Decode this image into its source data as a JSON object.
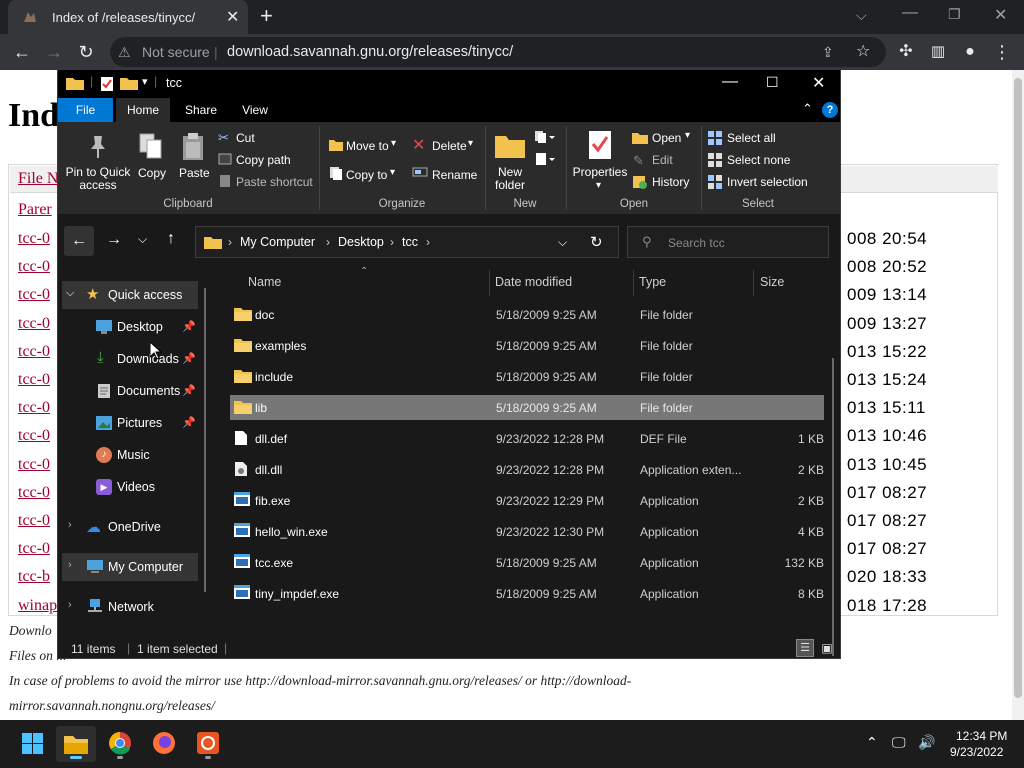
{
  "browser": {
    "tab_title": "Index of /releases/tinycc/",
    "new_tab": "+",
    "security_label": "Not secure",
    "url": "download.savannah.gnu.org/releases/tinycc/"
  },
  "webpage": {
    "title_partial": "Ind",
    "header_partial": "File N",
    "parent_link": "Parer",
    "links": [
      "tcc-0",
      "tcc-0",
      "tcc-0",
      "tcc-0",
      "tcc-0",
      "tcc-0",
      "tcc-0",
      "tcc-0",
      "tcc-0",
      "tcc-0",
      "tcc-0",
      "tcc-0",
      "tcc-b",
      "winap"
    ],
    "dates": [
      "008 20:54",
      "008 20:52",
      "009 13:14",
      "009 13:27",
      "013 15:22",
      "013 15:24",
      "013 15:11",
      "013 10:46",
      "013 10:45",
      "017 08:27",
      "017 08:27",
      "017 08:27",
      "020 18:33",
      "018 17:28"
    ],
    "note1": "Downlo",
    "note2": "Files on ...",
    "note3": "In case of problems to avoid the mirror use http://download-mirror.savannah.gnu.org/releases/ or http://download-",
    "note4": "mirror.savannah.nongnu.org/releases/"
  },
  "explorer": {
    "title": "tcc",
    "ribbon_tabs": [
      "File",
      "Home",
      "Share",
      "View"
    ],
    "clipboard": {
      "pin": "Pin to Quick access",
      "copy": "Copy",
      "paste": "Paste",
      "cut": "Cut",
      "copy_path": "Copy path",
      "paste_shortcut": "Paste shortcut",
      "label": "Clipboard"
    },
    "organize": {
      "move_to": "Move to",
      "copy_to": "Copy to",
      "delete": "Delete",
      "rename": "Rename",
      "label": "Organize"
    },
    "new_group": {
      "new_folder": "New folder",
      "label": "New"
    },
    "open_group": {
      "properties": "Properties",
      "open": "Open",
      "edit": "Edit",
      "history": "History",
      "label": "Open"
    },
    "select_group": {
      "select_all": "Select all",
      "select_none": "Select none",
      "invert": "Invert selection",
      "label": "Select"
    },
    "breadcrumb": [
      "My Computer",
      "Desktop",
      "tcc"
    ],
    "search_placeholder": "Search tcc",
    "nav": {
      "quick_access": "Quick access",
      "desktop": "Desktop",
      "downloads": "Downloads",
      "documents": "Documents",
      "pictures": "Pictures",
      "music": "Music",
      "videos": "Videos",
      "onedrive": "OneDrive",
      "my_computer": "My Computer",
      "network": "Network"
    },
    "columns": {
      "name": "Name",
      "date": "Date modified",
      "type": "Type",
      "size": "Size"
    },
    "files": [
      {
        "name": "doc",
        "date": "5/18/2009 9:25 AM",
        "type": "File folder",
        "size": "",
        "icon": "folder"
      },
      {
        "name": "examples",
        "date": "5/18/2009 9:25 AM",
        "type": "File folder",
        "size": "",
        "icon": "folder"
      },
      {
        "name": "include",
        "date": "5/18/2009 9:25 AM",
        "type": "File folder",
        "size": "",
        "icon": "folder"
      },
      {
        "name": "lib",
        "date": "5/18/2009 9:25 AM",
        "type": "File folder",
        "size": "",
        "icon": "folder"
      },
      {
        "name": "dll.def",
        "date": "9/23/2022 12:28 PM",
        "type": "DEF File",
        "size": "1 KB",
        "icon": "file"
      },
      {
        "name": "dll.dll",
        "date": "9/23/2022 12:28 PM",
        "type": "Application exten...",
        "size": "2 KB",
        "icon": "dll"
      },
      {
        "name": "fib.exe",
        "date": "9/23/2022 12:29 PM",
        "type": "Application",
        "size": "2 KB",
        "icon": "exe"
      },
      {
        "name": "hello_win.exe",
        "date": "9/23/2022 12:30 PM",
        "type": "Application",
        "size": "4 KB",
        "icon": "exe"
      },
      {
        "name": "tcc.exe",
        "date": "5/18/2009 9:25 AM",
        "type": "Application",
        "size": "132 KB",
        "icon": "exe"
      },
      {
        "name": "tiny_impdef.exe",
        "date": "5/18/2009 9:25 AM",
        "type": "Application",
        "size": "8 KB",
        "icon": "exe"
      }
    ],
    "selected_file": "lib",
    "status_items": "11 items",
    "status_selected": "1 item selected"
  },
  "taskbar": {
    "time": "12:34 PM",
    "date": "9/23/2022"
  },
  "colors": {
    "accent_blue": "#0078d4",
    "folder_yellow": "#f2c14e",
    "link_red": "#a0002c"
  }
}
